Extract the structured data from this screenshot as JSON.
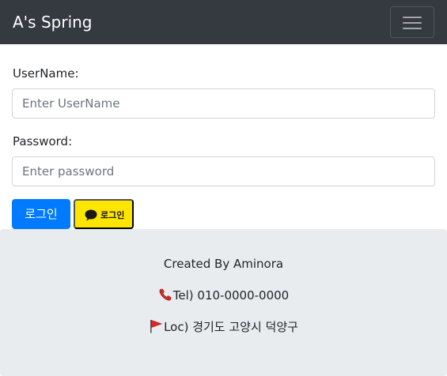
{
  "navbar": {
    "brand": "A's Spring",
    "toggler_icon": "hamburger-icon"
  },
  "form": {
    "username_label": "UserName:",
    "username_value": "",
    "username_placeholder": "Enter UserName",
    "password_label": "Password:",
    "password_value": "",
    "password_placeholder": "Enter password",
    "login_button": "로그인",
    "kakao_login_button": "로그인",
    "kakao_icon": "speech-bubble-icon"
  },
  "footer": {
    "created_by": "Created By Aminora",
    "tel": "Tel) 010-0000-0000",
    "tel_icon": "telephone-icon",
    "loc": "Loc) 경기도 고양시 덕양구",
    "loc_icon": "red-flag-icon"
  },
  "colors": {
    "navbar_bg": "#343a40",
    "primary": "#007bff",
    "kakao_yellow": "#fee500",
    "footer_bg": "#e9ecef"
  }
}
